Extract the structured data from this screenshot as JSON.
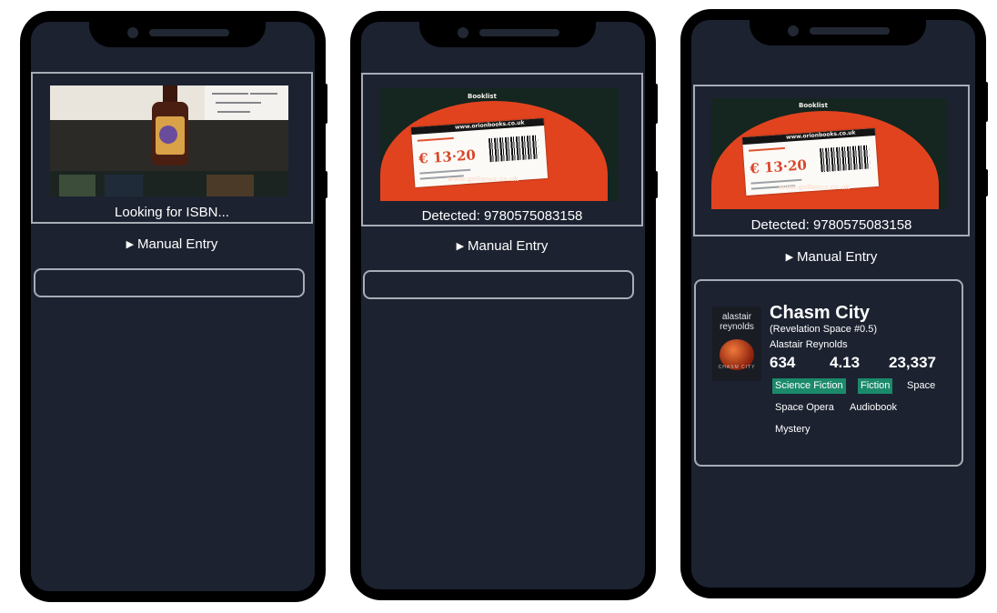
{
  "phones": [
    {
      "status": "Looking for ISBN...",
      "manual_entry": "Manual Entry"
    },
    {
      "status": "Detected: 9780575083158",
      "manual_entry": "Manual Entry",
      "camera_text": {
        "brand": "Booklist",
        "url": "www.orionbooks.co.uk",
        "price": "€ 13·20",
        "site": "www.gollancz.co.uk"
      }
    },
    {
      "status": "Detected: 9780575083158",
      "manual_entry": "Manual Entry",
      "camera_text": {
        "brand": "Booklist",
        "url": "www.orionbooks.co.uk",
        "price": "€ 13·20",
        "site": "www.gollancz.co.uk"
      },
      "book": {
        "cover_author": "alastair reynolds",
        "cover_title": "CHASM CITY",
        "title": "Chasm City",
        "series": "(Revelation Space #0.5)",
        "author": "Alastair Reynolds",
        "pages": "634",
        "rating": "4.13",
        "ratings_count": "23,337",
        "tags": [
          {
            "label": "Science Fiction",
            "highlighted": true
          },
          {
            "label": "Fiction",
            "highlighted": true
          },
          {
            "label": "Space",
            "highlighted": false
          },
          {
            "label": "Space Opera",
            "highlighted": false
          },
          {
            "label": "Audiobook",
            "highlighted": false
          },
          {
            "label": "Mystery",
            "highlighted": false
          }
        ]
      }
    }
  ],
  "colors": {
    "screen_bg": "#1c2230",
    "tag_highlight": "#1b8a6b",
    "panel_border": "#a8acb6"
  }
}
